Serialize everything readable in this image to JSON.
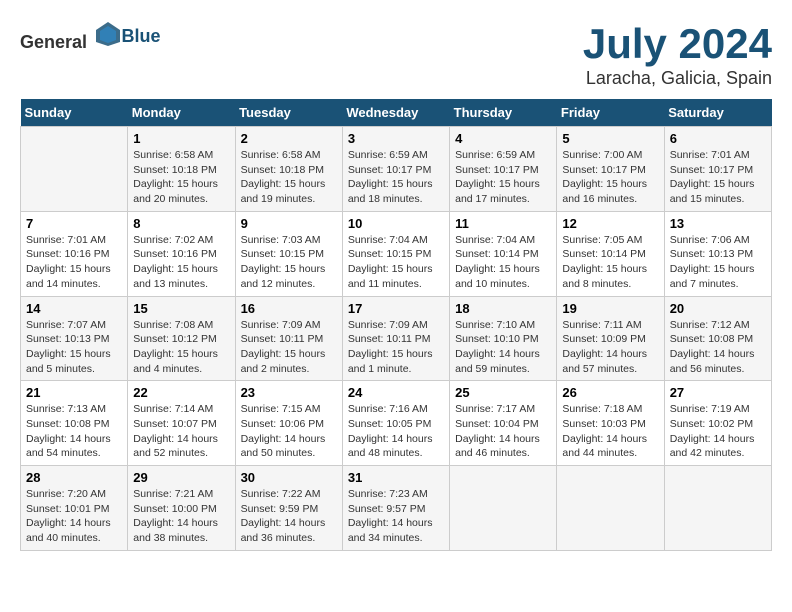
{
  "header": {
    "logo_general": "General",
    "logo_blue": "Blue",
    "title": "July 2024",
    "subtitle": "Laracha, Galicia, Spain"
  },
  "days_of_week": [
    "Sunday",
    "Monday",
    "Tuesday",
    "Wednesday",
    "Thursday",
    "Friday",
    "Saturday"
  ],
  "weeks": [
    [
      {
        "num": "",
        "info": ""
      },
      {
        "num": "1",
        "info": "Sunrise: 6:58 AM\nSunset: 10:18 PM\nDaylight: 15 hours\nand 20 minutes."
      },
      {
        "num": "2",
        "info": "Sunrise: 6:58 AM\nSunset: 10:18 PM\nDaylight: 15 hours\nand 19 minutes."
      },
      {
        "num": "3",
        "info": "Sunrise: 6:59 AM\nSunset: 10:17 PM\nDaylight: 15 hours\nand 18 minutes."
      },
      {
        "num": "4",
        "info": "Sunrise: 6:59 AM\nSunset: 10:17 PM\nDaylight: 15 hours\nand 17 minutes."
      },
      {
        "num": "5",
        "info": "Sunrise: 7:00 AM\nSunset: 10:17 PM\nDaylight: 15 hours\nand 16 minutes."
      },
      {
        "num": "6",
        "info": "Sunrise: 7:01 AM\nSunset: 10:17 PM\nDaylight: 15 hours\nand 15 minutes."
      }
    ],
    [
      {
        "num": "7",
        "info": "Sunrise: 7:01 AM\nSunset: 10:16 PM\nDaylight: 15 hours\nand 14 minutes."
      },
      {
        "num": "8",
        "info": "Sunrise: 7:02 AM\nSunset: 10:16 PM\nDaylight: 15 hours\nand 13 minutes."
      },
      {
        "num": "9",
        "info": "Sunrise: 7:03 AM\nSunset: 10:15 PM\nDaylight: 15 hours\nand 12 minutes."
      },
      {
        "num": "10",
        "info": "Sunrise: 7:04 AM\nSunset: 10:15 PM\nDaylight: 15 hours\nand 11 minutes."
      },
      {
        "num": "11",
        "info": "Sunrise: 7:04 AM\nSunset: 10:14 PM\nDaylight: 15 hours\nand 10 minutes."
      },
      {
        "num": "12",
        "info": "Sunrise: 7:05 AM\nSunset: 10:14 PM\nDaylight: 15 hours\nand 8 minutes."
      },
      {
        "num": "13",
        "info": "Sunrise: 7:06 AM\nSunset: 10:13 PM\nDaylight: 15 hours\nand 7 minutes."
      }
    ],
    [
      {
        "num": "14",
        "info": "Sunrise: 7:07 AM\nSunset: 10:13 PM\nDaylight: 15 hours\nand 5 minutes."
      },
      {
        "num": "15",
        "info": "Sunrise: 7:08 AM\nSunset: 10:12 PM\nDaylight: 15 hours\nand 4 minutes."
      },
      {
        "num": "16",
        "info": "Sunrise: 7:09 AM\nSunset: 10:11 PM\nDaylight: 15 hours\nand 2 minutes."
      },
      {
        "num": "17",
        "info": "Sunrise: 7:09 AM\nSunset: 10:11 PM\nDaylight: 15 hours\nand 1 minute."
      },
      {
        "num": "18",
        "info": "Sunrise: 7:10 AM\nSunset: 10:10 PM\nDaylight: 14 hours\nand 59 minutes."
      },
      {
        "num": "19",
        "info": "Sunrise: 7:11 AM\nSunset: 10:09 PM\nDaylight: 14 hours\nand 57 minutes."
      },
      {
        "num": "20",
        "info": "Sunrise: 7:12 AM\nSunset: 10:08 PM\nDaylight: 14 hours\nand 56 minutes."
      }
    ],
    [
      {
        "num": "21",
        "info": "Sunrise: 7:13 AM\nSunset: 10:08 PM\nDaylight: 14 hours\nand 54 minutes."
      },
      {
        "num": "22",
        "info": "Sunrise: 7:14 AM\nSunset: 10:07 PM\nDaylight: 14 hours\nand 52 minutes."
      },
      {
        "num": "23",
        "info": "Sunrise: 7:15 AM\nSunset: 10:06 PM\nDaylight: 14 hours\nand 50 minutes."
      },
      {
        "num": "24",
        "info": "Sunrise: 7:16 AM\nSunset: 10:05 PM\nDaylight: 14 hours\nand 48 minutes."
      },
      {
        "num": "25",
        "info": "Sunrise: 7:17 AM\nSunset: 10:04 PM\nDaylight: 14 hours\nand 46 minutes."
      },
      {
        "num": "26",
        "info": "Sunrise: 7:18 AM\nSunset: 10:03 PM\nDaylight: 14 hours\nand 44 minutes."
      },
      {
        "num": "27",
        "info": "Sunrise: 7:19 AM\nSunset: 10:02 PM\nDaylight: 14 hours\nand 42 minutes."
      }
    ],
    [
      {
        "num": "28",
        "info": "Sunrise: 7:20 AM\nSunset: 10:01 PM\nDaylight: 14 hours\nand 40 minutes."
      },
      {
        "num": "29",
        "info": "Sunrise: 7:21 AM\nSunset: 10:00 PM\nDaylight: 14 hours\nand 38 minutes."
      },
      {
        "num": "30",
        "info": "Sunrise: 7:22 AM\nSunset: 9:59 PM\nDaylight: 14 hours\nand 36 minutes."
      },
      {
        "num": "31",
        "info": "Sunrise: 7:23 AM\nSunset: 9:57 PM\nDaylight: 14 hours\nand 34 minutes."
      },
      {
        "num": "",
        "info": ""
      },
      {
        "num": "",
        "info": ""
      },
      {
        "num": "",
        "info": ""
      }
    ]
  ]
}
